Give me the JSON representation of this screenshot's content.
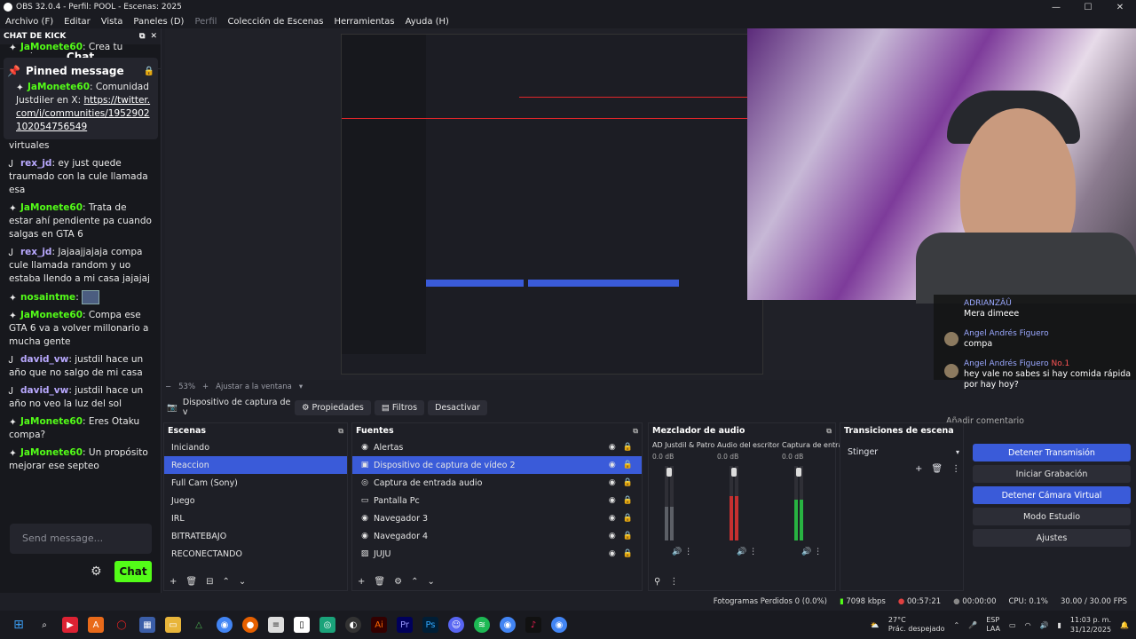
{
  "window": {
    "title": "OBS 32.0.4 - Perfil: POOL - Escenas: 2025"
  },
  "menu": [
    "Archivo (F)",
    "Editar",
    "Vista",
    "Paneles (D)",
    "Perfil",
    "Colección de Escenas",
    "Herramientas",
    "Ayuda (H)"
  ],
  "chat": {
    "dock_title": "CHAT DE KICK",
    "title": "Chat",
    "pinned_label": "Pinned message",
    "pinned": {
      "user": "JaMonete60",
      "text": "Comunidad Justdiler en X: ",
      "link": "https://twitter.com/i/communities/1952902102054756549"
    },
    "top_partial": {
      "user": "JaMonete60",
      "text": "Crea tu propio"
    },
    "partial_text": "virtuales",
    "messages": [
      {
        "user": "rex_jd",
        "text": "ey just quede traumado con la cule llamada esa",
        "color": "grey"
      },
      {
        "user": "JaMonete60",
        "text": "Trata de estar ahí pendiente pa cuando salgas en GTA 6",
        "color": "green"
      },
      {
        "user": "rex_jd",
        "text": "Jajaajjajaja compa cule llamada random y uo estaba llendo a mi casa jajajaj",
        "color": "grey"
      },
      {
        "user": "nosaintme",
        "text": "",
        "color": "green",
        "emote": true
      },
      {
        "user": "JaMonete60",
        "text": "Compa ese GTA 6 va a volver millonario a mucha gente",
        "color": "green"
      },
      {
        "user": "david_vw",
        "text": "justdil hace un año que no salgo de mi casa",
        "color": "grey"
      },
      {
        "user": "david_vw",
        "text": "justdil hace un año no veo la luz del sol",
        "color": "grey"
      },
      {
        "user": "JaMonete60",
        "text": "Eres Otaku compa?",
        "color": "green"
      },
      {
        "user": "JaMonete60",
        "text": "Un propósito mejorar ese septeo",
        "color": "green"
      }
    ],
    "input_placeholder": "Send message...",
    "send_label": "Chat"
  },
  "stream_overlay": {
    "top_user": "ADRIANZÂÛ",
    "top_text": "Mera dimeee",
    "messages": [
      {
        "user": "Angel Andrés Figuero",
        "text": "compa"
      },
      {
        "user": "Angel Andrés Figuero",
        "badge": "No.1",
        "text": "hey vale no sabes si hay comida rápida por hay hoy?"
      }
    ],
    "input_placeholder": "Añadir comentario"
  },
  "preview": {
    "zoom": "53%",
    "fit_label": "Ajustar a la ventana"
  },
  "source_toolbar": {
    "source_name": "Dispositivo de captura de v",
    "properties": "Propiedades",
    "filters": "Filtros",
    "deactivate": "Desactivar"
  },
  "scenes": {
    "title": "Escenas",
    "items": [
      "Iniciando",
      "Reaccion",
      "Full Cam (Sony)",
      "Juego",
      "IRL",
      "BITRATEBAJO",
      "RECONECTANDO"
    ],
    "selected": 1
  },
  "sources": {
    "title": "Fuentes",
    "items": [
      {
        "label": "Alertas",
        "icon": "browser-icon"
      },
      {
        "label": "Dispositivo de captura de vídeo 2",
        "icon": "camera-icon"
      },
      {
        "label": "Captura de entrada audio",
        "icon": "mic-icon"
      },
      {
        "label": "Pantalla Pc",
        "icon": "monitor-icon"
      },
      {
        "label": "Navegador 3",
        "icon": "browser-icon"
      },
      {
        "label": "Navegador 4",
        "icon": "browser-icon"
      },
      {
        "label": "JUJU",
        "icon": "image-icon"
      }
    ],
    "selected": 1
  },
  "mixer": {
    "title": "Mezclador de audio",
    "channels": [
      {
        "name": "AD Justdil & Patroc",
        "db": "0.0 dB",
        "level": 0.45
      },
      {
        "name": "Audio del escritorio",
        "db": "0.0 dB",
        "level": 0.6
      },
      {
        "name": "Captura de entra",
        "db": "0.0 dB",
        "level": 0.55
      }
    ],
    "scale": [
      "0",
      "-5",
      "-10",
      "-15",
      "-20",
      "-25",
      "-30",
      "-35",
      "-40",
      "-45",
      "-50",
      "-55",
      "-60"
    ]
  },
  "transitions": {
    "title": "Transiciones de escena",
    "selected": "Stinger"
  },
  "controls": [
    {
      "label": "Detener Transmisión",
      "active": true
    },
    {
      "label": "Iniciar Grabación",
      "active": false
    },
    {
      "label": "Detener Cámara Virtual",
      "active": true
    },
    {
      "label": "Modo Estudio",
      "active": false
    },
    {
      "label": "Ajustes",
      "active": false
    }
  ],
  "status": {
    "dropped": "Fotogramas Perdidos 0 (0.0%)",
    "bitrate": "7098 kbps",
    "live_time": "00:57:21",
    "rec_time": "00:00:00",
    "cpu": "CPU: 0.1%",
    "fps": "30.00 / 30.00 FPS"
  },
  "tray": {
    "weather": "27°C",
    "weather_desc": "Prác. despejado",
    "lang": "ESP",
    "lang2": "LAA",
    "time": "11:03 p. m.",
    "date": "31/12/2025"
  },
  "colors": {
    "accent": "#3a5bd9",
    "kick_green": "#53fc18"
  }
}
